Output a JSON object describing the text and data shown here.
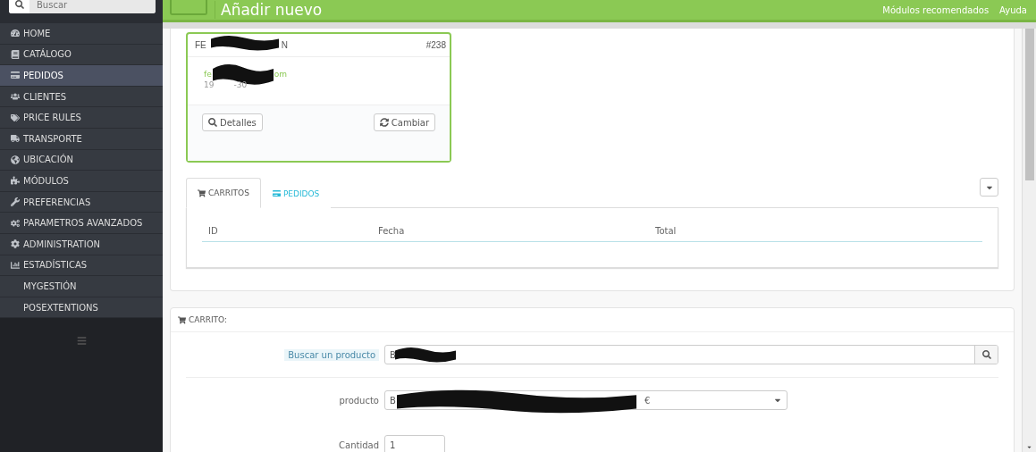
{
  "sidebar": {
    "search": {
      "placeholder": "Buscar"
    },
    "items": [
      {
        "label": "HOME",
        "selected": false
      },
      {
        "label": "CATÁLOGO",
        "selected": false
      },
      {
        "label": "PEDIDOS",
        "selected": true
      },
      {
        "label": "CLIENTES",
        "selected": false
      },
      {
        "label": "PRICE RULES",
        "selected": false
      },
      {
        "label": "TRANSPORTE",
        "selected": false
      },
      {
        "label": "UBICACIÓN",
        "selected": false
      },
      {
        "label": "MÓDULOS",
        "selected": false
      },
      {
        "label": "PREFERENCIAS",
        "selected": false
      },
      {
        "label": "PARAMETROS AVANZADOS",
        "selected": false
      },
      {
        "label": "ADMINISTRATION",
        "selected": false
      },
      {
        "label": "ESTADÍSTICAS",
        "selected": false
      },
      {
        "label": "MYGESTIÓN",
        "selected": false
      },
      {
        "label": "POSEXTENTIONS",
        "selected": false
      }
    ]
  },
  "header": {
    "title": "Añadir nuevo",
    "links": [
      "Módulos recomendados",
      "Ayuda"
    ]
  },
  "customer": {
    "name_start": "FE",
    "name_end": "N",
    "number": "#238",
    "email_start": "fe",
    "email_end": "om",
    "birthdate_start": "19",
    "birthdate_end": "-30",
    "buttons": [
      "Detalles",
      "Cambiar"
    ]
  },
  "history": {
    "tabs": [
      {
        "label": "CARRITOS",
        "selected": true
      },
      {
        "label": "PEDIDOS",
        "selected": false
      }
    ],
    "columns": [
      "ID",
      "Fecha",
      "Total"
    ]
  },
  "cart": {
    "title": "CARRITO:",
    "search_label": "Buscar un producto",
    "search_value": "B",
    "product_label": "producto",
    "product_value_start": "B",
    "product_value_end": "€",
    "quantity_label": "Cantidad",
    "quantity_value": "1"
  }
}
